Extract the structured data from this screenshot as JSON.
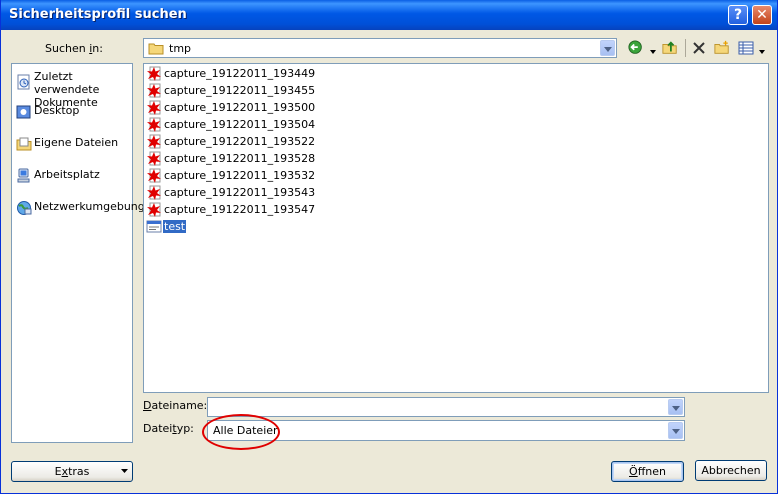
{
  "window": {
    "title": "Sicherheitsprofil suchen"
  },
  "lookin": {
    "label_pre": "Suchen ",
    "label_key": "i",
    "label_post": "n:",
    "value": "tmp"
  },
  "places": [
    {
      "line1": "Zuletzt verwendete",
      "line2": "Dokumente"
    },
    {
      "line1": "Desktop",
      "line2": ""
    },
    {
      "line1": "Eigene Dateien",
      "line2": ""
    },
    {
      "line1": "Arbeitsplatz",
      "line2": ""
    },
    {
      "line1": "Netzwerkumgebung",
      "line2": ""
    }
  ],
  "files": [
    "capture_19122011_193449",
    "capture_19122011_193455",
    "capture_19122011_193500",
    "capture_19122011_193504",
    "capture_19122011_193522",
    "capture_19122011_193528",
    "capture_19122011_193532",
    "capture_19122011_193543",
    "capture_19122011_193547",
    "test"
  ],
  "filename": {
    "label_key": "D",
    "label_rest": "ateiname:",
    "value": ""
  },
  "filetype": {
    "label_pre": "Datei",
    "label_key": "t",
    "label_post": "yp:",
    "value": "Alle Dateien"
  },
  "buttons": {
    "extras_pre": "E",
    "extras_key": "x",
    "extras_post": "tras",
    "open_key": "Ö",
    "open_rest": "ffnen",
    "cancel": "Abbrechen"
  },
  "colors": {
    "accent": "#0054e3",
    "highlight": "#316ac5",
    "annotation": "#e00000"
  }
}
